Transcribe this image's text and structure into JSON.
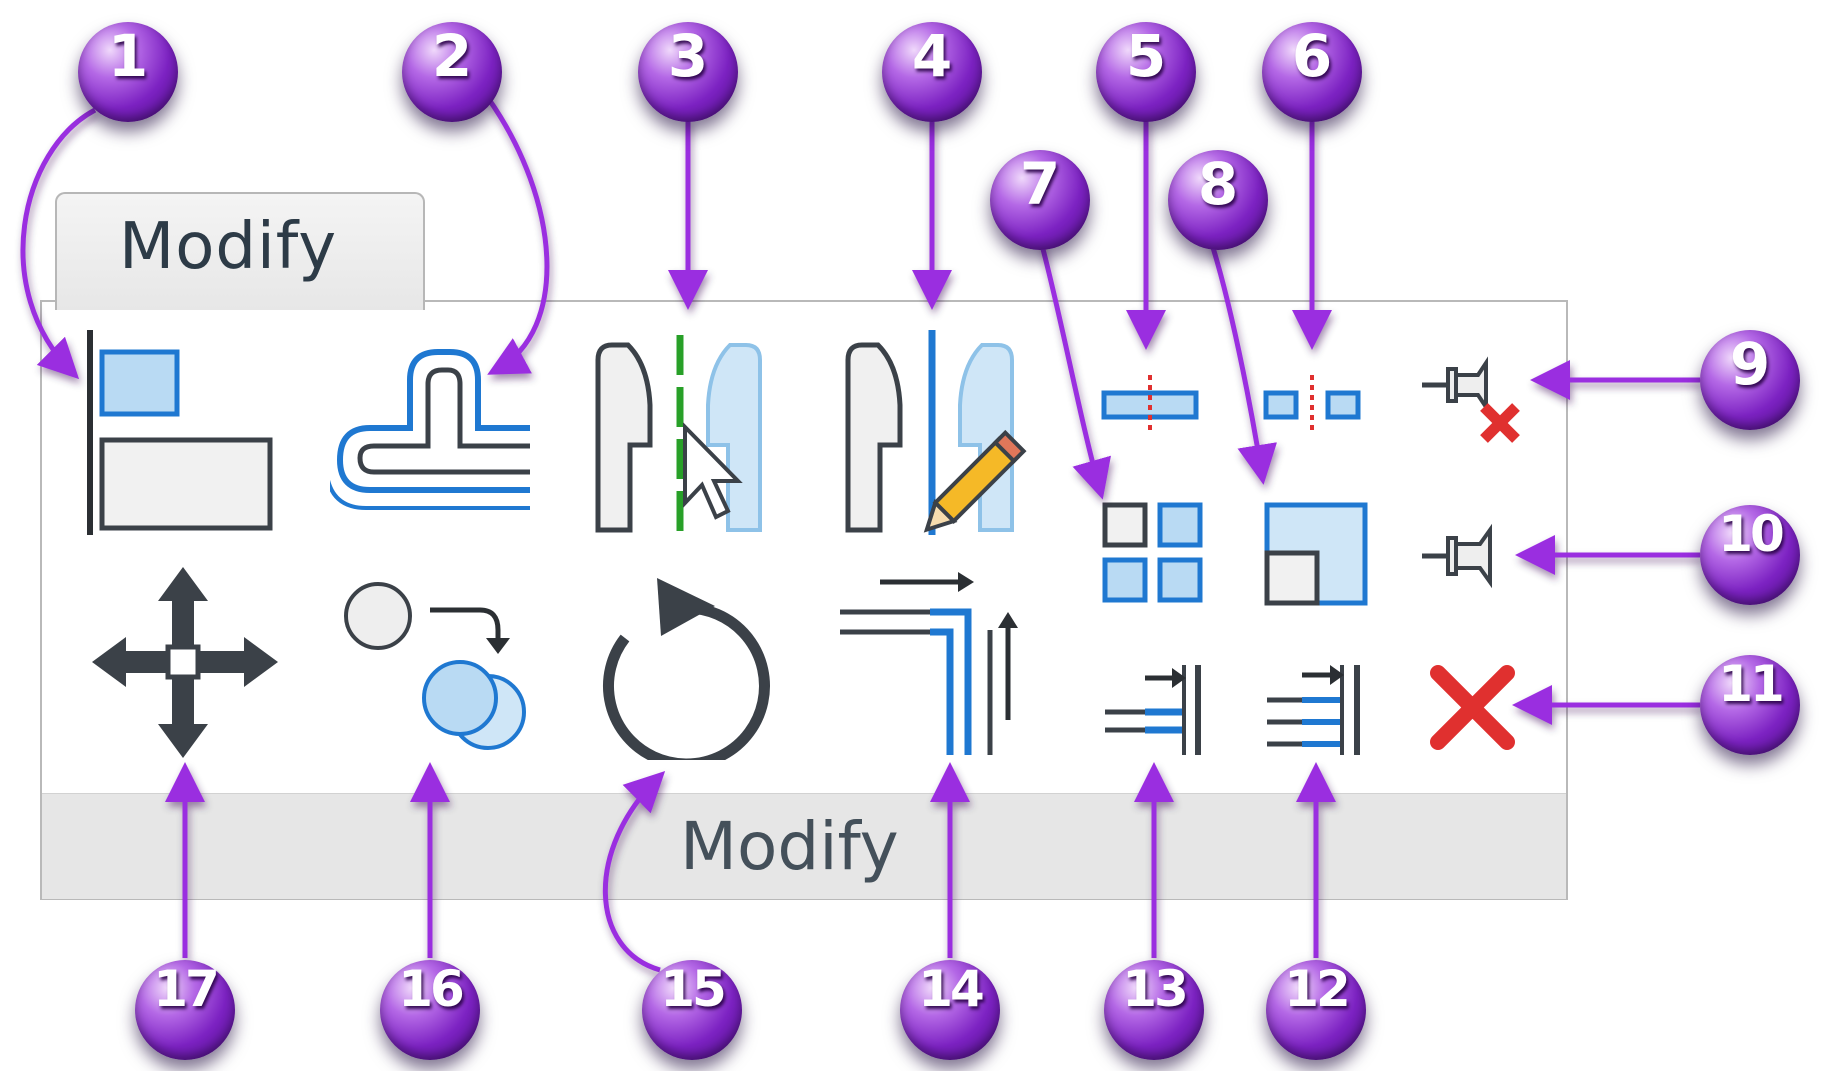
{
  "ribbon": {
    "tab_label": "Modify",
    "panel_title": "Modify",
    "tools": [
      {
        "id": "align",
        "icon": "align-icon"
      },
      {
        "id": "offset",
        "icon": "offset-icon"
      },
      {
        "id": "mirror-pick-axis",
        "icon": "mirror-pick-axis-icon"
      },
      {
        "id": "mirror-draw-axis",
        "icon": "mirror-draw-axis-icon"
      },
      {
        "id": "split-element",
        "icon": "split-element-icon"
      },
      {
        "id": "split-with-gap",
        "icon": "split-with-gap-icon"
      },
      {
        "id": "array",
        "icon": "array-icon"
      },
      {
        "id": "scale",
        "icon": "scale-icon"
      },
      {
        "id": "unpin",
        "icon": "unpin-icon"
      },
      {
        "id": "pin",
        "icon": "pin-icon"
      },
      {
        "id": "delete",
        "icon": "delete-icon"
      },
      {
        "id": "trim-extend-multiple",
        "icon": "trim-extend-multiple-icon"
      },
      {
        "id": "trim-extend-single",
        "icon": "trim-extend-single-icon"
      },
      {
        "id": "trim-extend-to-corner",
        "icon": "trim-extend-to-corner-icon"
      },
      {
        "id": "rotate",
        "icon": "rotate-icon"
      },
      {
        "id": "copy",
        "icon": "copy-icon"
      },
      {
        "id": "move",
        "icon": "move-icon"
      }
    ]
  },
  "callouts": [
    "1",
    "2",
    "3",
    "4",
    "5",
    "6",
    "7",
    "8",
    "9",
    "10",
    "11",
    "12",
    "13",
    "14",
    "15",
    "16",
    "17"
  ],
  "colors": {
    "callout_purple": "#8a2be2",
    "arrow_purple": "#9a2fe0",
    "icon_blue": "#1f78d1",
    "icon_fill_blue": "#b9daf3",
    "icon_dark": "#3b4148",
    "delete_red": "#e0302f",
    "panel_footer": "#e6e6e6"
  }
}
